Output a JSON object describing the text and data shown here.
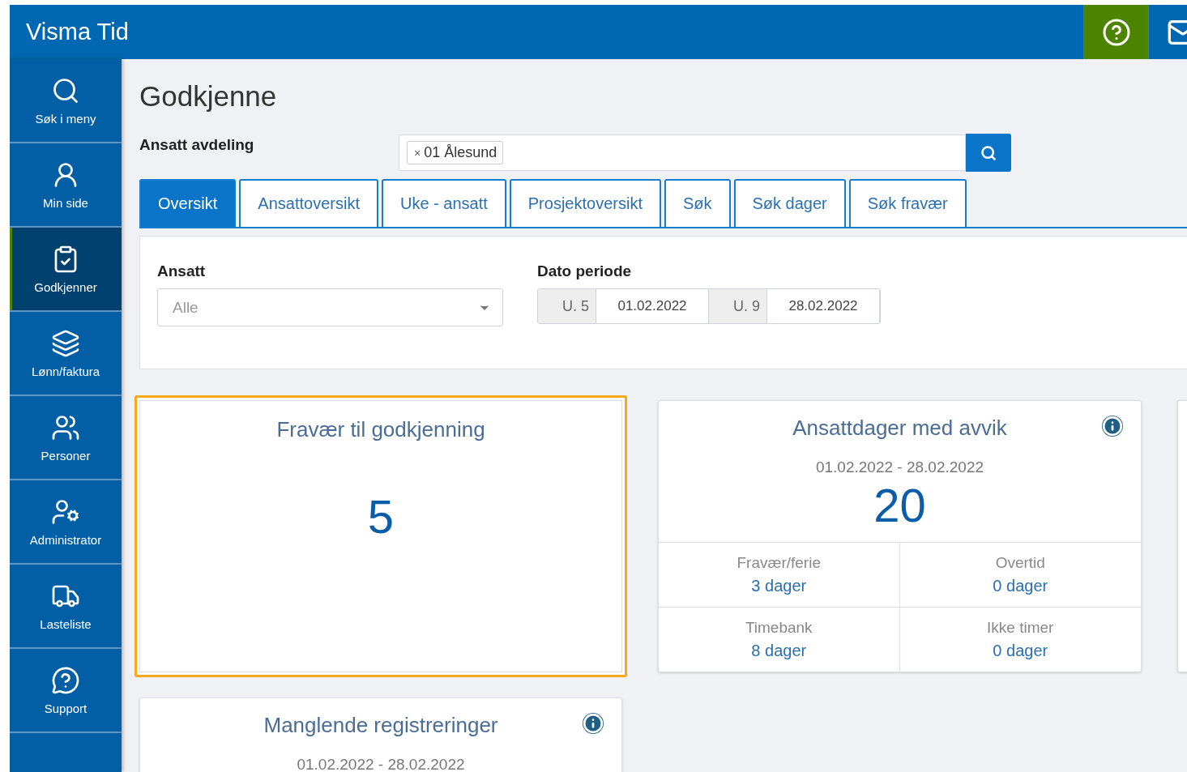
{
  "app": {
    "title": "Visma Tid"
  },
  "sidebar": {
    "items": [
      {
        "label": "Søk i meny",
        "kind": "search",
        "selected": false
      },
      {
        "label": "Min side",
        "kind": "user",
        "selected": false
      },
      {
        "label": "Godkjenner",
        "kind": "approve",
        "selected": true
      },
      {
        "label": "Lønn/faktura",
        "kind": "money",
        "selected": false
      },
      {
        "label": "Personer",
        "kind": "users",
        "selected": false
      },
      {
        "label": "Administrator",
        "kind": "admin",
        "selected": false
      },
      {
        "label": "Lasteliste",
        "kind": "truck",
        "selected": false
      },
      {
        "label": "Support",
        "kind": "support",
        "selected": false
      }
    ]
  },
  "page": {
    "title": "Godkjenne"
  },
  "department": {
    "label": "Ansatt avdeling",
    "tags": [
      {
        "remove": "×",
        "label": "01 Ålesund"
      }
    ]
  },
  "tabs": [
    {
      "label": "Oversikt",
      "selected": true
    },
    {
      "label": "Ansattoversikt",
      "selected": false
    },
    {
      "label": "Uke - ansatt",
      "selected": false
    },
    {
      "label": "Prosjektoversikt",
      "selected": false
    },
    {
      "label": "Søk",
      "selected": false
    },
    {
      "label": "Søk dager",
      "selected": false
    },
    {
      "label": "Søk fravær",
      "selected": false
    }
  ],
  "filters": {
    "employee": {
      "label": "Ansatt",
      "placeholder": "Alle"
    },
    "period": {
      "label": "Dato periode",
      "from_week": "U. 5",
      "from_date": "01.02.2022",
      "to_week": "U. 9",
      "to_date": "28.02.2022"
    }
  },
  "cards": [
    {
      "kind": "count",
      "title": "Fravær til godkjenning",
      "value": "5",
      "selected": true
    },
    {
      "kind": "summary",
      "title": "Ansattdager med avvik",
      "info": true,
      "period": "01.02.2022 - 28.02.2022",
      "value": "20",
      "selected": false,
      "stats": [
        {
          "label": "Fravær/ferie",
          "value": "3 dager"
        },
        {
          "label": "Overtid",
          "value": "0 dager"
        },
        {
          "label": "Timebank",
          "value": "8 dager"
        },
        {
          "label": "Ikke timer",
          "value": "0 dager"
        }
      ]
    },
    {
      "kind": "blank"
    },
    {
      "kind": "summary",
      "title": "Manglende registreringer",
      "info": true,
      "period": "01.02.2022 - 28.02.2022",
      "selected": false
    }
  ]
}
